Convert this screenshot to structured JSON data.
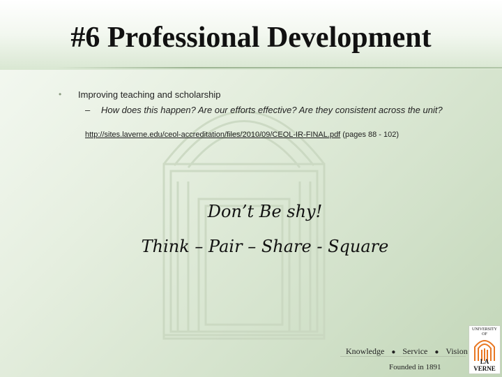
{
  "slide": {
    "title": "#6 Professional Development",
    "bullets": [
      {
        "marker": "•",
        "text": "Improving teaching and scholarship",
        "sub": {
          "marker": "–",
          "text": "How does this happen?  Are our efforts effective?  Are they consistent across the unit?"
        }
      }
    ],
    "link": {
      "url_text": "http://sites.laverne.edu/ceol-accreditation/files/2010/09/CEOL-IR-FINAL.pdf",
      "suffix": " (pages 88 - 102)"
    },
    "prompt_lines": [
      "Don’t Be shy!",
      "Think – Pair – Share - Square"
    ]
  },
  "footer": {
    "motto": [
      "Knowledge",
      "Service",
      "Vision"
    ],
    "separator": "●",
    "founded": "Founded in 1891"
  },
  "logo": {
    "top_text": "UNIVERSITY OF",
    "bottom_text": "LA VERNE",
    "accent_color": "#e87722"
  },
  "colors": {
    "background": "#dde8d6",
    "title_text": "#111111",
    "watermark": "#c9d7c0"
  }
}
